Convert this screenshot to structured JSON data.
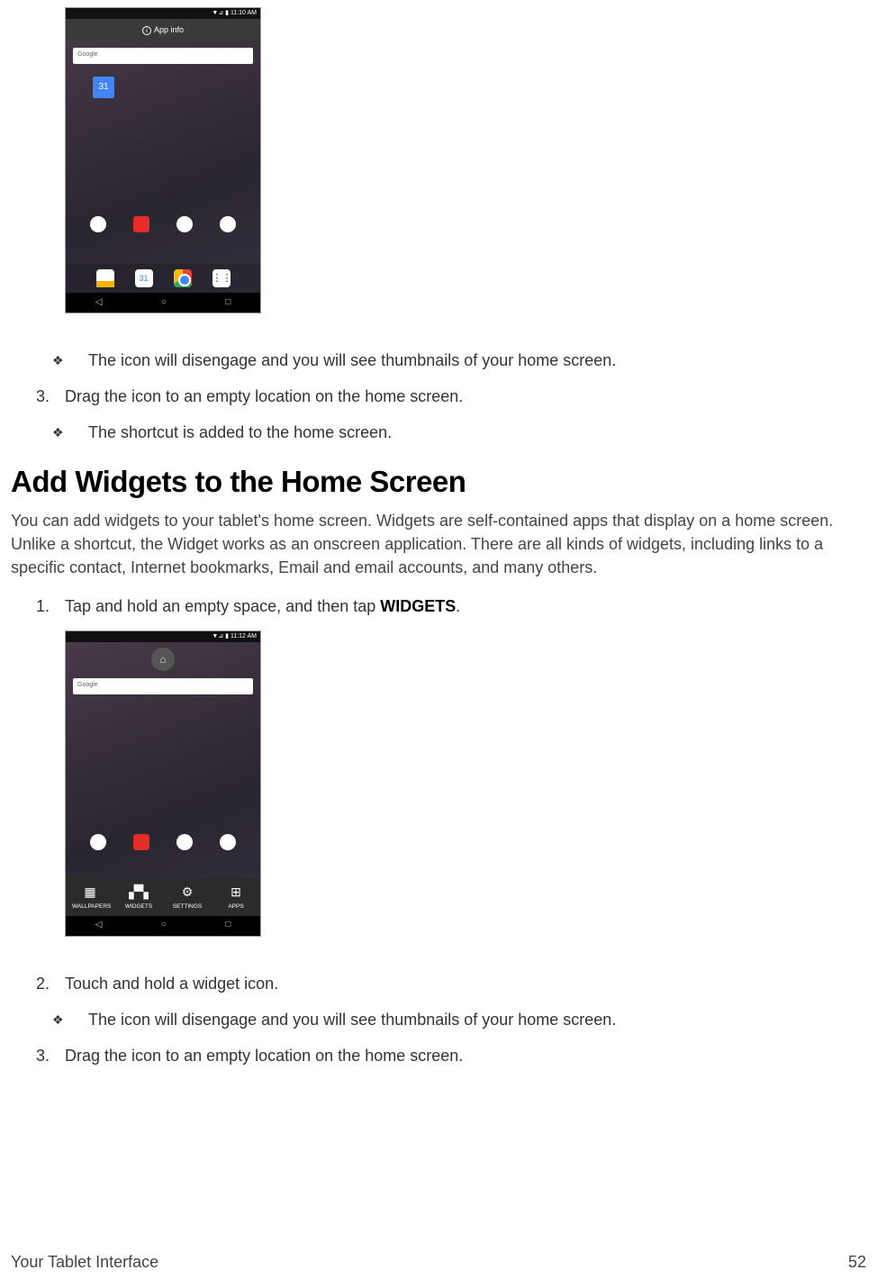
{
  "screenshot1": {
    "status_time": "▼⊿ ▮ 11:10 AM",
    "topbar_label": "App info",
    "search_label": "Google",
    "calendar_day": "31",
    "dock_cal": "31",
    "apps_glyph": "⋮⋮⋮",
    "nav_back": "◁",
    "nav_home": "○",
    "nav_recent": "□"
  },
  "bullets": {
    "b1": "The icon will disengage and you will see thumbnails of your home screen.",
    "n3": "Drag the icon to an empty location on the home screen.",
    "b2": "The shortcut is added to the home screen."
  },
  "heading": "Add Widgets to the Home Screen",
  "paragraph": "You can add widgets to your tablet's home screen. Widgets are self-contained apps that display on a home screen. Unlike a shortcut, the Widget works as an onscreen application. There are all kinds of widgets, including links to a specific contact, Internet bookmarks, Email and email accounts, and many others.",
  "step1_pre": "Tap and hold an empty space, and then tap ",
  "step1_bold": "WIDGETS",
  "step1_post": ".",
  "screenshot2": {
    "status_time": "▼⊿ ▮ 11:12 AM",
    "home_glyph": "⌂",
    "search_label": "Google",
    "bb_wallpapers": "WALLPAPERS",
    "bb_widgets": "WIDGETS",
    "bb_settings": "SETTINGS",
    "bb_apps": "APPS",
    "nav_back": "◁",
    "nav_home": "○",
    "nav_recent": "□"
  },
  "step2": "Touch and hold a widget icon.",
  "bullets2": {
    "b1": "The icon will disengage and you will see thumbnails of your home screen.",
    "n3": "Drag the icon to an empty location on the home screen."
  },
  "numbers": {
    "n1": "1.",
    "n2": "2.",
    "n3": "3."
  },
  "bullet_glyph": "❖",
  "footer": {
    "left": "Your Tablet Interface",
    "page": "52"
  }
}
